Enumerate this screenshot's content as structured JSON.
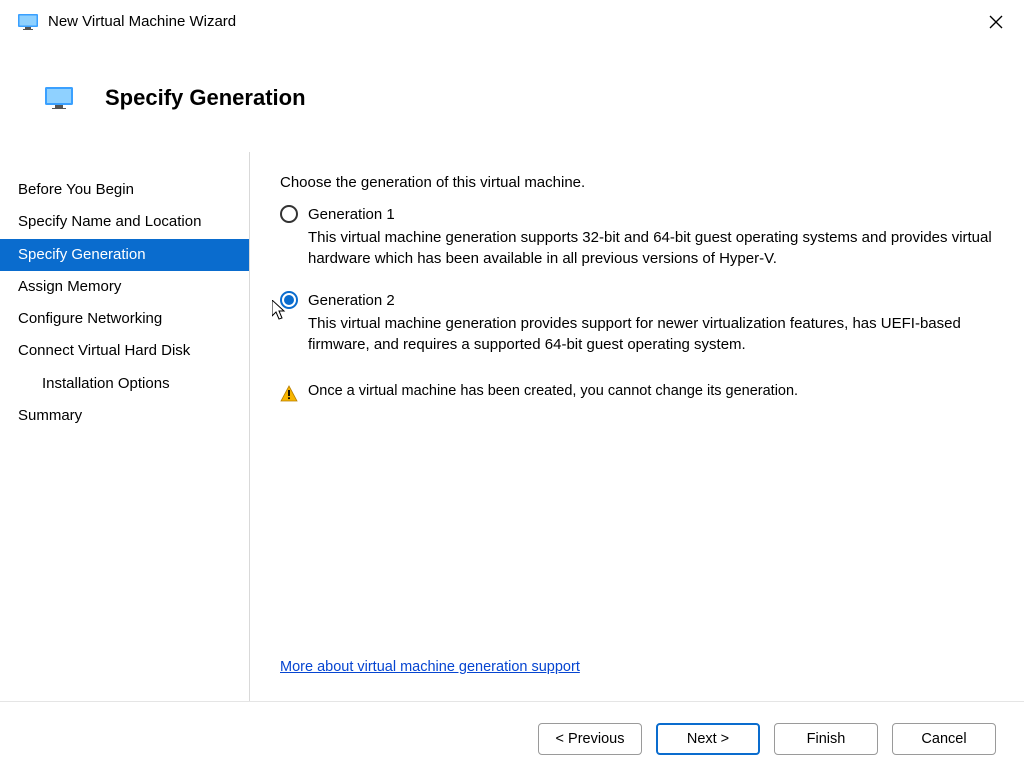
{
  "window": {
    "title": "New Virtual Machine Wizard"
  },
  "header": {
    "page_title": "Specify Generation"
  },
  "sidebar": {
    "items": [
      {
        "label": "Before You Begin",
        "selected": false,
        "indent": false
      },
      {
        "label": "Specify Name and Location",
        "selected": false,
        "indent": false
      },
      {
        "label": "Specify Generation",
        "selected": true,
        "indent": false
      },
      {
        "label": "Assign Memory",
        "selected": false,
        "indent": false
      },
      {
        "label": "Configure Networking",
        "selected": false,
        "indent": false
      },
      {
        "label": "Connect Virtual Hard Disk",
        "selected": false,
        "indent": false
      },
      {
        "label": "Installation Options",
        "selected": false,
        "indent": true
      },
      {
        "label": "Summary",
        "selected": false,
        "indent": false
      }
    ]
  },
  "content": {
    "intro": "Choose the generation of this virtual machine.",
    "option1": {
      "label": "Generation 1",
      "desc": "This virtual machine generation supports 32-bit and 64-bit guest operating systems and provides virtual hardware which has been available in all previous versions of Hyper-V."
    },
    "option2": {
      "label": "Generation 2",
      "desc": "This virtual machine generation provides support for newer virtualization features, has UEFI-based firmware, and requires a supported 64-bit guest operating system."
    },
    "selected_option": "option2",
    "warning": "Once a virtual machine has been created, you cannot change its generation.",
    "link": "More about virtual machine generation support"
  },
  "footer": {
    "previous": "< Previous",
    "next": "Next >",
    "finish": "Finish",
    "cancel": "Cancel"
  }
}
